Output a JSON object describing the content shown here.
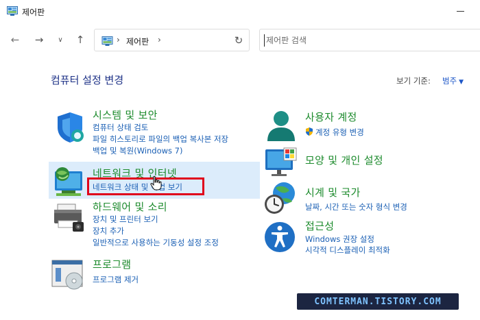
{
  "window": {
    "title": "제어판"
  },
  "nav": {
    "address": "제어판",
    "separator": "›",
    "search_placeholder": "제어판 검색"
  },
  "header": {
    "title": "컴퓨터 설정 변경",
    "view_by_label": "보기 기준:",
    "view_by_value": "범주"
  },
  "left_categories": [
    {
      "title": "시스템 및 보안",
      "links": [
        "컴퓨터 상태 검토",
        "파일 히스토리로 파일의 백업 복사본 저장",
        "백업 및 복원(Windows 7)"
      ]
    },
    {
      "title": "네트워크 및 인터넷",
      "links": [
        "네트워크 상태 및 작업 보기"
      ]
    },
    {
      "title": "하드웨어 및 소리",
      "links": [
        "장치 및 프린터 보기",
        "장치 추가",
        "일반적으로 사용하는 기동성 설정 조정"
      ]
    },
    {
      "title": "프로그램",
      "links": [
        "프로그램 제거"
      ]
    }
  ],
  "right_categories": [
    {
      "title": "사용자 계정",
      "links": [
        "계정 유형 변경"
      ]
    },
    {
      "title": "모양 및 개인 설정",
      "links": []
    },
    {
      "title": "시계 및 국가",
      "links": [
        "날짜, 시간 또는 숫자 형식 변경"
      ]
    },
    {
      "title": "접근성",
      "links": [
        "Windows 권장 설정",
        "시각적 디스플레이 최적화"
      ]
    }
  ],
  "watermark": "COMTERMAN.TISTORY.COM",
  "colors": {
    "title_blue": "#1e3287",
    "category_green": "#1b8a2b",
    "link_blue": "#1a5fb4",
    "highlight": "#dcecfb",
    "annotation_red": "#e0001b"
  }
}
